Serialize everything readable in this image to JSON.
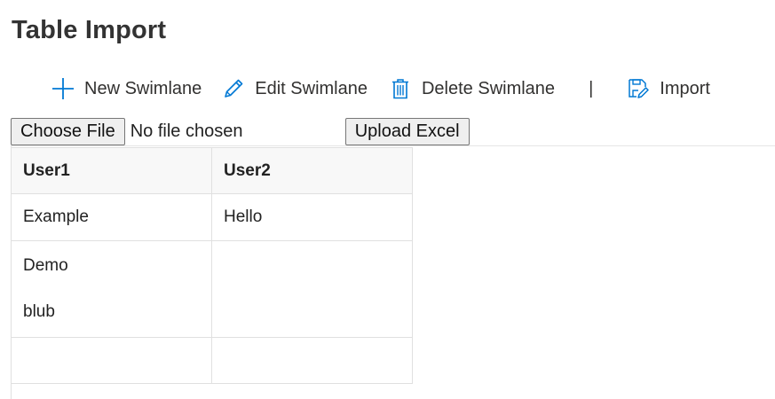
{
  "page": {
    "title": "Table Import"
  },
  "toolbar": {
    "new_label": "New Swimlane",
    "edit_label": "Edit Swimlane",
    "delete_label": "Delete Swimlane",
    "separator": "|",
    "import_label": "Import",
    "icon_color": "#0078d4"
  },
  "file_upload": {
    "choose_label": "Choose File",
    "status_text": "No file chosen",
    "upload_label": "Upload Excel"
  },
  "table": {
    "headers": [
      "User1",
      "User2"
    ],
    "rows": [
      {
        "user1": [
          "Example"
        ],
        "user2": [
          "Hello"
        ]
      },
      {
        "user1": [
          "Demo",
          "blub"
        ],
        "user2": []
      },
      {
        "user1": [],
        "user2": []
      }
    ]
  }
}
